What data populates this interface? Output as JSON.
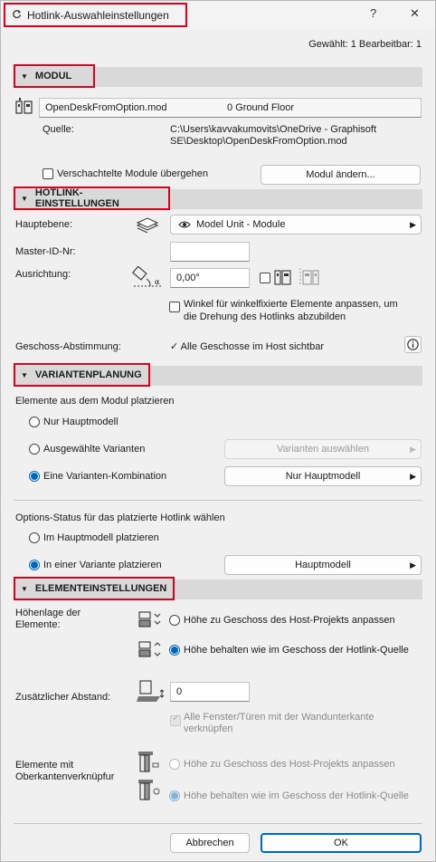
{
  "window": {
    "title": "Hotlink-Auswahleinstellungen",
    "help": "?",
    "close": "✕"
  },
  "selection_info": "Gewählt: 1 Bearbeitbar: 1",
  "module": {
    "header": "MODUL",
    "file_name": "OpenDeskFromOption.mod",
    "floor": "0 Ground Floor",
    "source_label": "Quelle:",
    "source_path_line1": "C:\\Users\\kavvakumovits\\OneDrive - Graphisoft",
    "source_path_line2": "SE\\Desktop\\OpenDeskFromOption.mod",
    "skip_nested_label": "Verschachtelte Module übergehen",
    "change_module_button": "Modul ändern..."
  },
  "hotlink": {
    "header": "HOTLINK-EINSTELLUNGEN",
    "main_layer_label": "Hauptebene:",
    "main_layer_value": "Model Unit - Module",
    "master_id_label": "Master-ID-Nr:",
    "master_id_value": "",
    "orientation_label": "Ausrichtung:",
    "orientation_value": "0,00°",
    "angle_label_line1": "Winkel für winkelfixierte Elemente anpassen, um",
    "angle_label_line2": "die Drehung des Hotlinks abzubilden",
    "story_match_label": "Geschoss-Abstimmung:",
    "story_match_value": "✓  Alle Geschosse im Host sichtbar"
  },
  "variants": {
    "header": "VARIANTENPLANUNG",
    "place_elements_label": "Elemente aus dem Modul platzieren",
    "option_main_only": "Nur Hauptmodell",
    "option_selected_variants": "Ausgewählte Varianten",
    "select_variants_button": "Varianten auswählen",
    "option_combination": "Eine Varianten-Kombination",
    "combination_value": "Nur Hauptmodell",
    "status_label": "Options-Status für das platzierte Hotlink wählen",
    "status_main": "Im Hauptmodell platzieren",
    "status_variant": "In einer Variante platzieren",
    "status_variant_value": "Hauptmodell"
  },
  "elements": {
    "header": "ELEMENTEINSTELLUNGEN",
    "height_label_line1": "Höhenlage der",
    "height_label_line2": "Elemente:",
    "height_option_host": "Höhe zu Geschoss des Host-Projekts anpassen",
    "height_option_keep": "Höhe behalten wie im Geschoss der Hotlink-Quelle",
    "extra_distance_label": "Zusätzlicher Abstand:",
    "extra_distance_value": "0",
    "link_windows_line1": "Alle Fenster/Türen mit der Wandunterkante",
    "link_windows_line2": "verknüpfen",
    "top_link_label_line1": "Elemente mit",
    "top_link_label_line2": "Oberkantenverknüpfur",
    "top_option_host": "Höhe zu Geschoss des Host-Projekts anpassen",
    "top_option_keep": "Höhe behalten wie im Geschoss der Hotlink-Quelle"
  },
  "footer": {
    "cancel": "Abbrechen",
    "ok": "OK"
  },
  "colors": {
    "accent": "#0067c0",
    "highlight": "#e0001b",
    "section_bg": "#d9d9d9"
  }
}
